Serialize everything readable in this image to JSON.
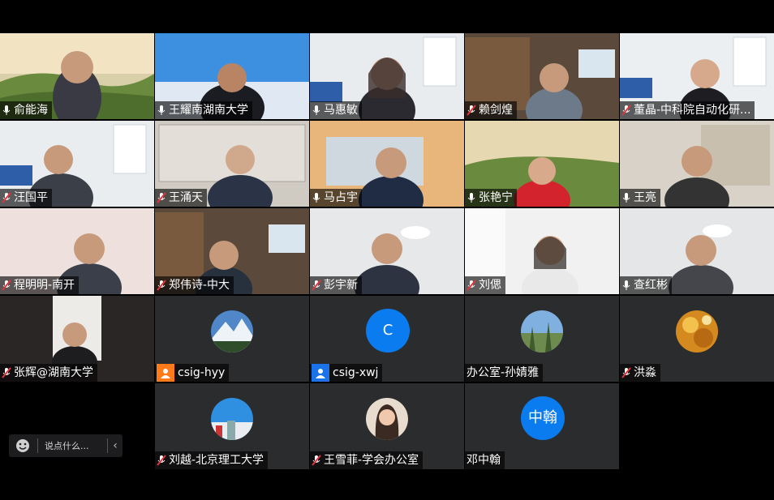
{
  "participants": [
    {
      "name": "俞能海",
      "mic": "on"
    },
    {
      "name": "王耀南湖南大学",
      "mic": "on"
    },
    {
      "name": "马惠敏",
      "mic": "on"
    },
    {
      "name": "赖剑煌",
      "mic": "muted"
    },
    {
      "name": "董晶-中科院自动化研...",
      "mic": "muted"
    },
    {
      "name": "汪国平",
      "mic": "muted"
    },
    {
      "name": "王涌天",
      "mic": "muted"
    },
    {
      "name": "马占宇",
      "mic": "on"
    },
    {
      "name": "张艳宁",
      "mic": "on"
    },
    {
      "name": "王亮",
      "mic": "on"
    },
    {
      "name": "程明明-南开",
      "mic": "muted"
    },
    {
      "name": "郑伟诗-中大",
      "mic": "muted"
    },
    {
      "name": "彭宇新",
      "mic": "muted"
    },
    {
      "name": "刘偲",
      "mic": "muted"
    },
    {
      "name": "查红彬",
      "mic": "on"
    },
    {
      "name": "张辉@湖南大学",
      "mic": "muted"
    },
    {
      "name": "csig-hyy",
      "badge": "orange"
    },
    {
      "name": "csig-xwj",
      "badge": "blue",
      "avatar_letter": "C"
    },
    {
      "name": "办公室-孙婧雅"
    },
    {
      "name": "洪淼",
      "mic": "muted"
    },
    {
      "name": "刘越-北京理工大学",
      "mic": "muted"
    },
    {
      "name": "王雪菲-学会办公室",
      "mic": "muted"
    },
    {
      "name": "邓中翰",
      "avatar_letter": "中翰"
    }
  ],
  "chat": {
    "placeholder": "说点什么..."
  },
  "colors": {
    "accent": "#0a7cf0",
    "muted_mic": "#e0353c",
    "badge_orange": "#ff7a18",
    "badge_blue": "#1a73e8",
    "tile_bg": "#2b2c2e"
  }
}
